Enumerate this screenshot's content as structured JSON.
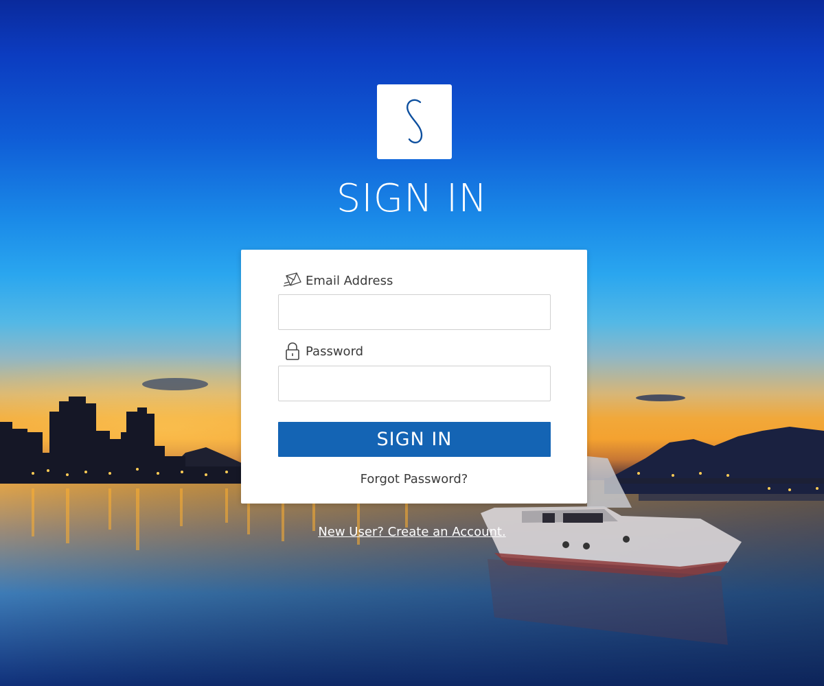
{
  "app": {
    "logo_letter": "S",
    "logo_icon": "stylized-s-logo-icon",
    "title": "SIGN IN"
  },
  "form": {
    "email_label": "Email Address",
    "email_icon": "envelope-icon",
    "email_value": "",
    "password_label": "Password",
    "password_icon": "padlock-icon",
    "password_value": "",
    "submit_label": "SIGN IN",
    "forgot_label": "Forgot Password?"
  },
  "footer": {
    "create_account_label": "New User? Create an Account."
  },
  "colors": {
    "primary_button": "#1464b4",
    "logo_stroke": "#0d4f9e",
    "card_background": "#ffffff",
    "title_text": "#ffffff"
  }
}
